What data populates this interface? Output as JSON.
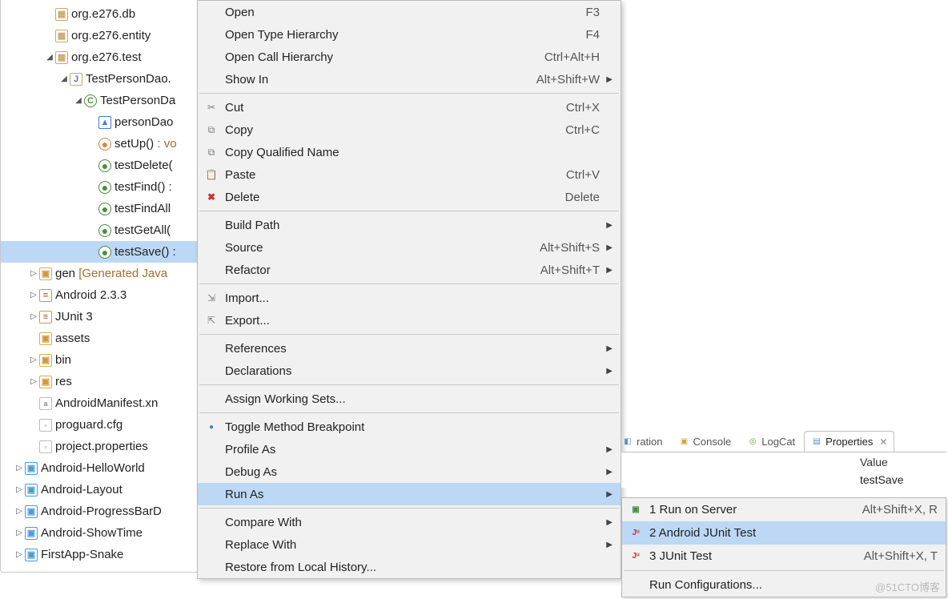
{
  "tree": {
    "pkg_db": "org.e276.db",
    "pkg_entity": "org.e276.entity",
    "pkg_test": "org.e276.test",
    "file_testdao": "TestPersonDao.",
    "class_testdao": "TestPersonDa",
    "field_persondao": "personDao",
    "method_setup": "setUp()",
    "method_setup_suffix": " : vo",
    "method_delete": "testDelete(",
    "method_find": "testFind() :",
    "method_findall": "testFindAll",
    "method_getall": "testGetAll(",
    "method_save": "testSave() :",
    "gen": "gen ",
    "gen_suffix": "[Generated Java",
    "android": "Android 2.3.3",
    "junit": "JUnit 3",
    "assets": "assets",
    "bin": "bin",
    "res": "res",
    "manifest": "AndroidManifest.xn",
    "proguard": "proguard.cfg",
    "projprop": "project.properties",
    "proj_hello": "Android-HelloWorld",
    "proj_layout": "Android-Layout",
    "proj_progress": "Android-ProgressBarD",
    "proj_showtime": "Android-ShowTime",
    "proj_snake": "FirstApp-Snake"
  },
  "menu": {
    "open": "Open",
    "open_k": "F3",
    "open_th": "Open Type Hierarchy",
    "open_th_k": "F4",
    "open_ch": "Open Call Hierarchy",
    "open_ch_k": "Ctrl+Alt+H",
    "show_in": "Show In",
    "show_in_k": "Alt+Shift+W",
    "cut": "Cut",
    "cut_k": "Ctrl+X",
    "copy": "Copy",
    "copy_k": "Ctrl+C",
    "copy_q": "Copy Qualified Name",
    "paste": "Paste",
    "paste_k": "Ctrl+V",
    "delete": "Delete",
    "delete_k": "Delete",
    "build_path": "Build Path",
    "source": "Source",
    "source_k": "Alt+Shift+S",
    "refactor": "Refactor",
    "refactor_k": "Alt+Shift+T",
    "import": "Import...",
    "export": "Export...",
    "references": "References",
    "declarations": "Declarations",
    "assign_ws": "Assign Working Sets...",
    "toggle_bp": "Toggle Method Breakpoint",
    "profile_as": "Profile As",
    "debug_as": "Debug As",
    "run_as": "Run As",
    "compare": "Compare With",
    "replace": "Replace With",
    "restore": "Restore from Local History..."
  },
  "submenu": {
    "run_server": "1 Run on Server",
    "run_server_k": "Alt+Shift+X, R",
    "android_junit": "2 Android JUnit Test",
    "junit_test": "3 JUnit Test",
    "junit_test_k": "Alt+Shift+X, T",
    "run_config": "Run Configurations..."
  },
  "tabs": {
    "declaration": "ration",
    "console": "Console",
    "logcat": "LogCat",
    "properties": "Properties"
  },
  "properties": {
    "header_value": "Value",
    "value": "testSave"
  },
  "watermark": "@51CTO博客"
}
